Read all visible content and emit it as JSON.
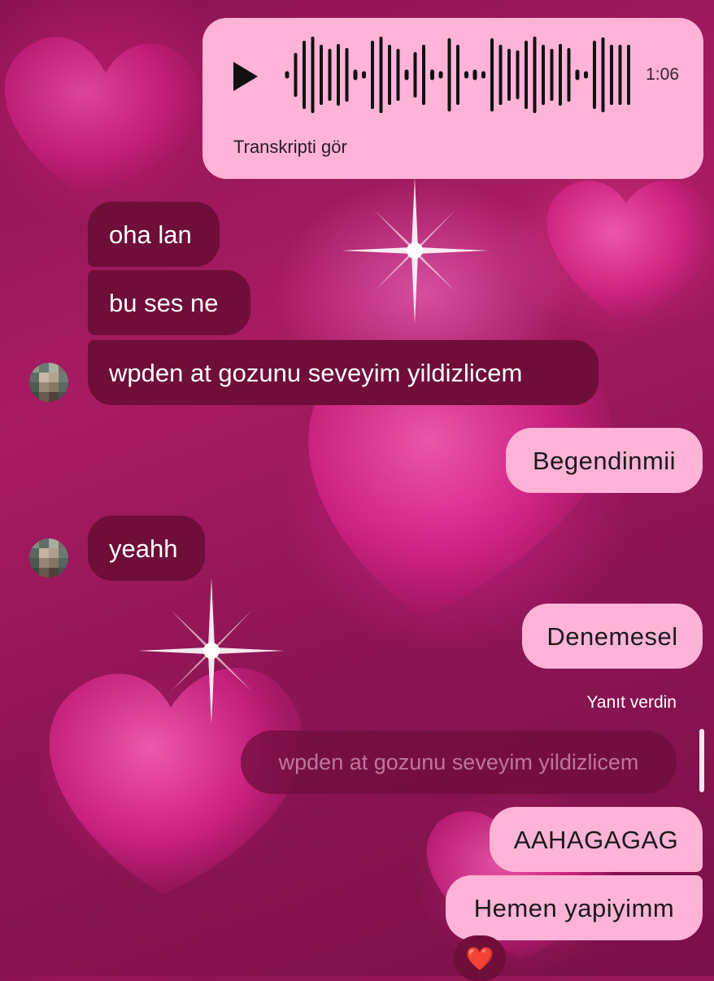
{
  "theme": {
    "outgoing_bubble": "#ffb3d6",
    "incoming_bubble": "#6f0e38",
    "background": "#a81b62"
  },
  "voice_message": {
    "duration": "1:06",
    "transcript_link": "Transkripti gör",
    "icon": "play-icon"
  },
  "messages": [
    {
      "direction": "incoming",
      "text": "oha lan"
    },
    {
      "direction": "incoming",
      "text": "bu ses ne"
    },
    {
      "direction": "incoming",
      "text": "wpden at gozunu seveyim yildizlicem"
    },
    {
      "direction": "outgoing",
      "text": "Begendinmii"
    },
    {
      "direction": "incoming",
      "text": "yeahh"
    },
    {
      "direction": "outgoing",
      "text": "Denemesel"
    },
    {
      "direction": "outgoing",
      "text": "AAHAGAGAG"
    },
    {
      "direction": "outgoing",
      "text": "Hemen yapiyimm"
    }
  ],
  "reply": {
    "label": "Yanıt verdin",
    "quoted_text": "wpden at gozunu seveyim yildizlicem"
  },
  "reaction": {
    "emoji": "❤️",
    "icon": "heart-reaction-icon"
  }
}
